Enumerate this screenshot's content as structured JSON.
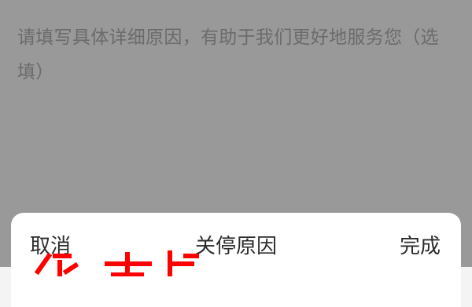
{
  "form": {
    "reason_placeholder": "请填写具体详细原因，有助于我们更好地服务您（选填）"
  },
  "picker": {
    "cancel_label": "取消",
    "title": "关停原因",
    "confirm_label": "完成"
  },
  "colors": {
    "overlay": "rgba(0,0,0,0.4)",
    "placeholder_text": "#b3b3b3",
    "sheet_text": "#2b2b2b",
    "watermark": "#ff0000"
  },
  "watermark": {
    "text": "简书步"
  }
}
